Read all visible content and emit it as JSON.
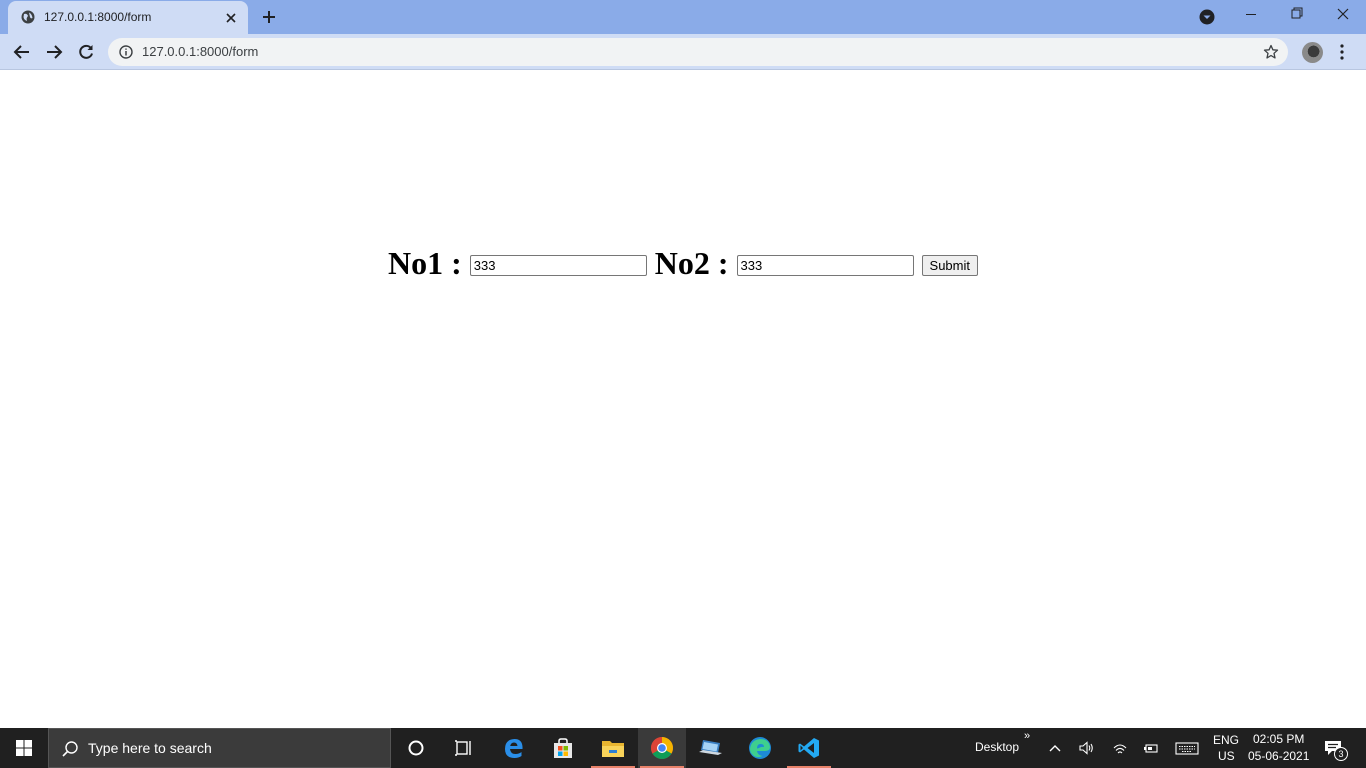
{
  "browser": {
    "tab_title": "127.0.0.1:8000/form",
    "url": "127.0.0.1:8000/form"
  },
  "form": {
    "no1_label": "No1 :",
    "no1_value": "333",
    "no2_label": "No2 :",
    "no2_value": "333",
    "submit_label": "Submit"
  },
  "taskbar": {
    "search_placeholder": "Type here to search",
    "desktop_label": "Desktop",
    "language_line1": "ENG",
    "language_line2": "US",
    "time": "02:05 PM",
    "date": "05-06-2021",
    "notification_count": "3",
    "pinned_apps": [
      "task-view",
      "edge-legacy",
      "store",
      "file-explorer",
      "chrome",
      "laptop-app",
      "edge",
      "vscode"
    ]
  },
  "colors": {
    "titlebar": "#8aabe8",
    "toolbar": "#cfdcf5",
    "taskbar": "#202020",
    "active_indicator": "#e8826a"
  }
}
